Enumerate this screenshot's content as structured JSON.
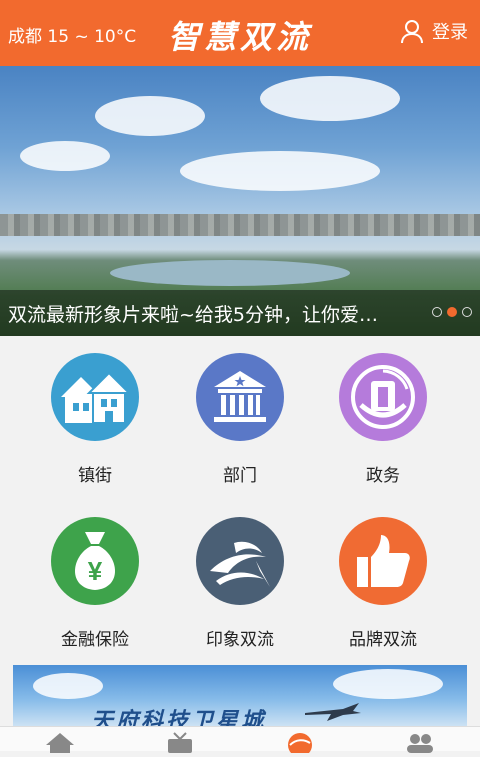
{
  "header": {
    "weather": "成都 15 ~ 10°C",
    "app_title": "智慧双流",
    "login_label": "登录"
  },
  "banner": {
    "caption": "双流最新形象片来啦~给我5分钟，让你爱…",
    "slides": 3,
    "active_slide": 2
  },
  "menu": [
    {
      "label": "镇街",
      "icon": "houses-icon",
      "color": "#3a9fd0"
    },
    {
      "label": "部门",
      "icon": "government-building-icon",
      "color": "#5a78c7"
    },
    {
      "label": "政务",
      "icon": "civic-emblem-icon",
      "color": "#b57bdb"
    },
    {
      "label": "金融保险",
      "icon": "money-bag-icon",
      "color": "#3ea34b"
    },
    {
      "label": "印象双流",
      "icon": "bird-logo-icon",
      "color": "#4a5f75"
    },
    {
      "label": "品牌双流",
      "icon": "thumbs-up-icon",
      "color": "#f06b33"
    }
  ],
  "ad_banner": {
    "text": "天府科技卫星城"
  },
  "tabbar": [
    "home-icon",
    "tv-icon",
    "logo-icon",
    "people-icon"
  ],
  "colors": {
    "accent": "#f26a2e"
  }
}
